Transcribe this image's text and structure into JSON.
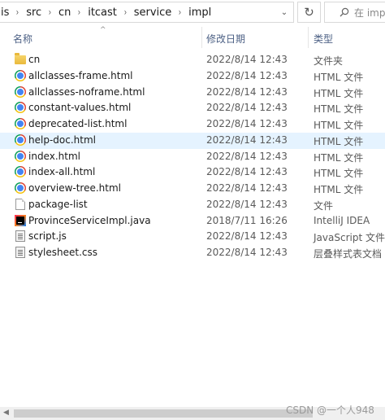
{
  "address_bar": {
    "crumbs": [
      "is",
      "src",
      "cn",
      "itcast",
      "service",
      "impl"
    ],
    "separator": "›",
    "dropdown_glyph": "⌄"
  },
  "refresh_glyph": "↻",
  "search": {
    "placeholder": "在 impl"
  },
  "columns": {
    "name": "名称",
    "date": "修改日期",
    "type": "类型"
  },
  "sort_indicator": "^",
  "files": [
    {
      "name": "cn",
      "date": "2022/8/14 12:43",
      "type": "文件夹",
      "icon": "folder-icon"
    },
    {
      "name": "allclasses-frame.html",
      "date": "2022/8/14 12:43",
      "type": "HTML 文件",
      "icon": "chrome-icon"
    },
    {
      "name": "allclasses-noframe.html",
      "date": "2022/8/14 12:43",
      "type": "HTML 文件",
      "icon": "chrome-icon"
    },
    {
      "name": "constant-values.html",
      "date": "2022/8/14 12:43",
      "type": "HTML 文件",
      "icon": "chrome-icon"
    },
    {
      "name": "deprecated-list.html",
      "date": "2022/8/14 12:43",
      "type": "HTML 文件",
      "icon": "chrome-icon"
    },
    {
      "name": "help-doc.html",
      "date": "2022/8/14 12:43",
      "type": "HTML 文件",
      "icon": "chrome-icon",
      "selected": true
    },
    {
      "name": "index.html",
      "date": "2022/8/14 12:43",
      "type": "HTML 文件",
      "icon": "chrome-icon"
    },
    {
      "name": "index-all.html",
      "date": "2022/8/14 12:43",
      "type": "HTML 文件",
      "icon": "chrome-icon"
    },
    {
      "name": "overview-tree.html",
      "date": "2022/8/14 12:43",
      "type": "HTML 文件",
      "icon": "chrome-icon"
    },
    {
      "name": "package-list",
      "date": "2022/8/14 12:43",
      "type": "文件",
      "icon": "document-icon"
    },
    {
      "name": "ProvinceServiceImpl.java",
      "date": "2018/7/11 16:26",
      "type": "IntelliJ IDEA",
      "icon": "intellij-icon"
    },
    {
      "name": "script.js",
      "date": "2022/8/14 12:43",
      "type": "JavaScript 文件",
      "icon": "javascript-file-icon"
    },
    {
      "name": "stylesheet.css",
      "date": "2022/8/14 12:43",
      "type": "层叠样式表文档",
      "icon": "css-file-icon"
    }
  ],
  "watermark": "CSDN @一个人948"
}
